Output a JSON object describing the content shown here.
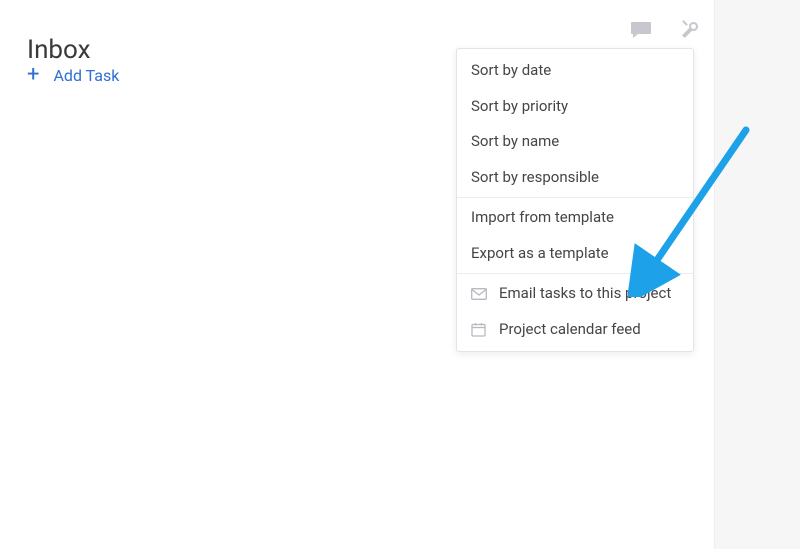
{
  "header": {
    "title": "Inbox"
  },
  "actions": {
    "add_task_label": "Add Task"
  },
  "dropdown": {
    "sort_date": "Sort by date",
    "sort_priority": "Sort by priority",
    "sort_name": "Sort by name",
    "sort_responsible": "Sort by responsible",
    "import_template": "Import from template",
    "export_template": "Export as a template",
    "email_tasks": "Email tasks to this project",
    "calendar_feed": "Project calendar feed"
  }
}
